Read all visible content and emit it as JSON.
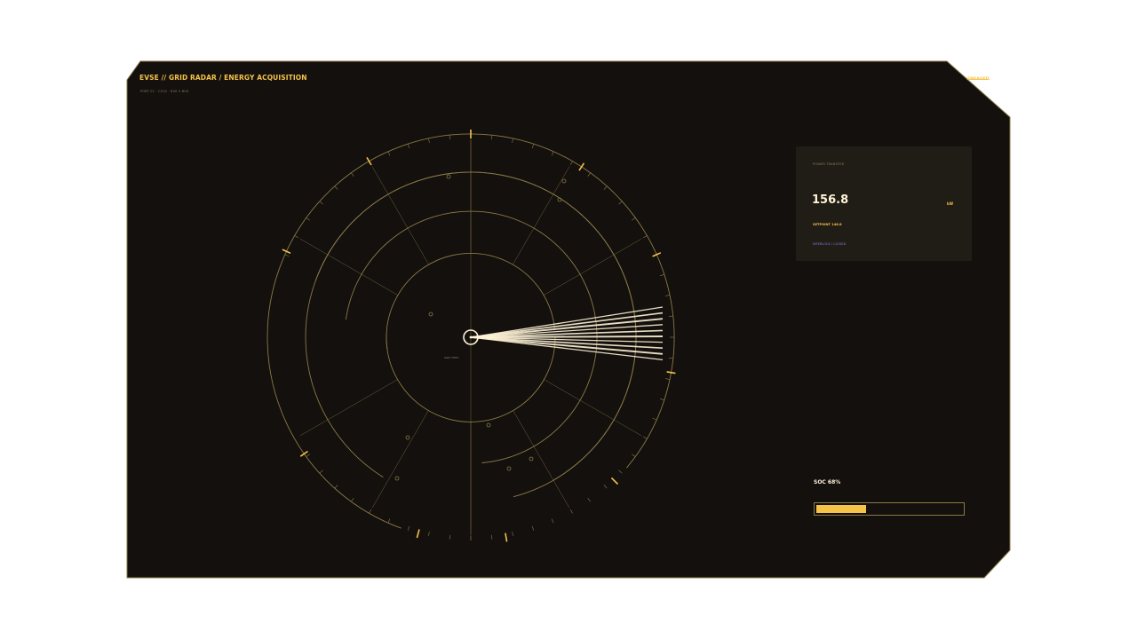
{
  "header": {
    "title": "EVSE // GRID RADAR / ENERGY ACQUISITION",
    "subtitle": "PORT 01 · CCS2 · 800 V BUS",
    "corner_tag": "ENGAGED"
  },
  "radar": {
    "center_label": "GRID FEED",
    "sweep_lines": 10
  },
  "power_panel": {
    "label": "POWER TRANSFER",
    "value": "156.8",
    "unit": "kW",
    "setpoint": "SETPOINT 146.8",
    "interlock": "INTERLOCK / CLOSED"
  },
  "soc": {
    "label": "SOC 68%",
    "percent": 68
  },
  "colors": {
    "background": "#ffffff",
    "panel": "#13100d",
    "card": "#201c16",
    "accent": "#f5c24a",
    "grid_line": "#8a7a48",
    "highlight": "#fff3d6",
    "interlock": "#8c7bd8"
  }
}
